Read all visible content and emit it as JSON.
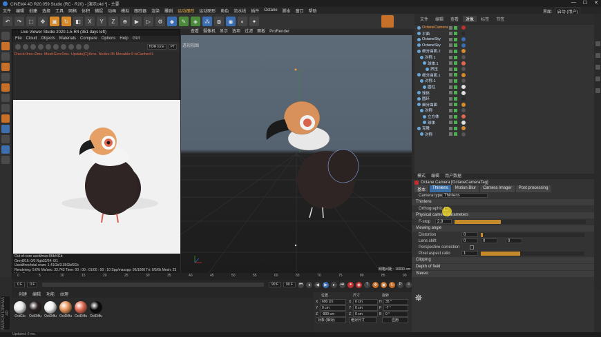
{
  "window": {
    "title": "CINEMA 4D R20.059 Studio (RC - R20) - [演示c4d *] - 主要",
    "controls": [
      "—",
      "☐",
      "✕"
    ]
  },
  "menu": [
    "文件",
    "编辑",
    "创建",
    "选择",
    "工具",
    "网格",
    "体积",
    "捕捉",
    "动画",
    "模拟",
    "跟踪器",
    "渲染",
    "雕刻",
    "运动跟踪",
    "运动图形",
    "角色",
    "流水线",
    "插件",
    "Octane",
    "脚本",
    "窗口",
    "帮助"
  ],
  "menu_highlight_index": 13,
  "interface_label": "界面:",
  "interface_value": "启动 (用户)",
  "live_viewer": {
    "title": "Live Viewer Studio 2020.1.5-R4 (351 days left)",
    "menu": [
      "File",
      "Cloud",
      "Objects",
      "Materials",
      "Compare",
      "Options",
      "Help",
      "GUI"
    ],
    "tonemap": "HDR tone",
    "pt": "PT",
    "status": "Check:0ms./2ms. MeshGen:0ms. Update[C]:0ms. Nodes:35 Movable:9 txCached:1",
    "info": [
      "Out-of-core used/max:0Kb/4Gb",
      "Grey8/16: 0/0          Rgb32/64: 0/1",
      "Used/free/total vram: 1.41Gb/3.35Gb/6Gb",
      "Rendering: 9.6%    Ms/sec: 33.743    Time: 00 : 00 : 01/00 : 00 : 10    Spp/maxspp: 96/1000    Tri: 0/5/6k    Mesh: 23    Hair: 0"
    ]
  },
  "viewport": {
    "menu": [
      "查看",
      "摄像机",
      "显示",
      "选项",
      "过滤",
      "面板",
      "ProRender"
    ],
    "label": "透视视图",
    "grid_info": "网格间距 : 10000 cm"
  },
  "object_manager": {
    "tabs": [
      "文件",
      "编辑",
      "查看",
      "对象",
      "标签",
      "书签"
    ],
    "active_tab": 3,
    "rows": [
      {
        "name": "OctaneCamera",
        "selected": true
      },
      {
        "name": "平面",
        "selected": false
      },
      {
        "name": "OctaneSky",
        "selected": false
      },
      {
        "name": "OctaneSky",
        "selected": false
      },
      {
        "name": "细分曲面.2",
        "selected": false
      },
      {
        "name": "对称.1",
        "selected": false
      },
      {
        "name": "球体.1",
        "selected": false
      },
      {
        "name": "挤压",
        "selected": false
      },
      {
        "name": "细分曲面.1",
        "selected": false
      },
      {
        "name": "对称.1",
        "selected": false
      },
      {
        "name": "圆柱",
        "selected": false
      },
      {
        "name": "球体",
        "selected": false
      },
      {
        "name": "圆环",
        "selected": false
      },
      {
        "name": "细分曲面",
        "selected": false
      },
      {
        "name": "对称",
        "selected": false
      },
      {
        "name": "立方体",
        "selected": false
      },
      {
        "name": "球体",
        "selected": false
      },
      {
        "name": "克隆",
        "selected": false
      },
      {
        "name": "对称",
        "selected": false
      }
    ]
  },
  "attributes": {
    "tabs": [
      "模式",
      "编辑",
      "用户数据"
    ],
    "header": "Octane Camera [OctaneCameraTag]",
    "subtabs": [
      "基本",
      "Thinlens",
      "Motion Blur",
      "Camera Imager",
      "Post processing"
    ],
    "active_subtab": 1,
    "camera_type_label": "Camera type",
    "camera_type_value": "Thinlens",
    "section_thinlens": "Thinlens",
    "orthographic_label": "Orthographic",
    "physical_section": "Physical camera parameters",
    "fstop_label": "F-stop",
    "fstop_value": "2.8",
    "fstop_level": 0.35,
    "viewing_section": "Viewing angle",
    "rows": [
      {
        "label": "Distortion",
        "value": "0",
        "level": 0.02
      },
      {
        "label": "Lens shift",
        "value": "0",
        "value2": "0",
        "value3": "0"
      },
      {
        "label": "Perspective correction",
        "value": ""
      },
      {
        "label": "Pixel aspect ratio",
        "value": "1",
        "level": 0.38
      }
    ],
    "collapsed_sections": [
      "Clipping",
      "Depth of field",
      "Stereo"
    ]
  },
  "timeline": {
    "ticks": [
      "0",
      "5",
      "10",
      "15",
      "20",
      "25",
      "30",
      "35",
      "40",
      "45",
      "50",
      "55",
      "60",
      "65",
      "70",
      "75",
      "80",
      "85",
      "90"
    ],
    "start": "0 F",
    "current": "0 F",
    "end": "90 F",
    "end2": "90 F",
    "frame_display": "0 F"
  },
  "materials": {
    "tabs": [
      "创建",
      "编辑",
      "功能",
      "纹理"
    ],
    "items": [
      {
        "label": "OctGlo",
        "color": "#e8e8e8"
      },
      {
        "label": "OctDiffu",
        "color": "#2a2322"
      },
      {
        "label": "OctDiffu",
        "color": "#f2f2f2"
      },
      {
        "label": "OctDiffu",
        "color": "#e8955a"
      },
      {
        "label": "OctDiffu",
        "color": "#e06a52"
      },
      {
        "label": "OctDiffu",
        "color": "#0a0a0a"
      }
    ]
  },
  "coordinates": {
    "headers": [
      "位置",
      "尺寸",
      "旋转"
    ],
    "rows": [
      {
        "axis": "X",
        "pos": "600 cm",
        "size": "0 cm",
        "rot_label": "H",
        "rot": "35 °"
      },
      {
        "axis": "Y",
        "pos": "0 cm",
        "size": "0 cm",
        "rot_label": "P",
        "rot": "-7 °"
      },
      {
        "axis": "Z",
        "pos": "-900 cm",
        "size": "0 cm",
        "rot_label": "B",
        "rot": "0 °"
      }
    ],
    "mode": "对象 (相对)",
    "size_mode": "绝对尺寸",
    "apply": "应用"
  },
  "status_bar": "Updated: 0 ms.",
  "brand_vertical": "MAXON CINEMA 4D"
}
